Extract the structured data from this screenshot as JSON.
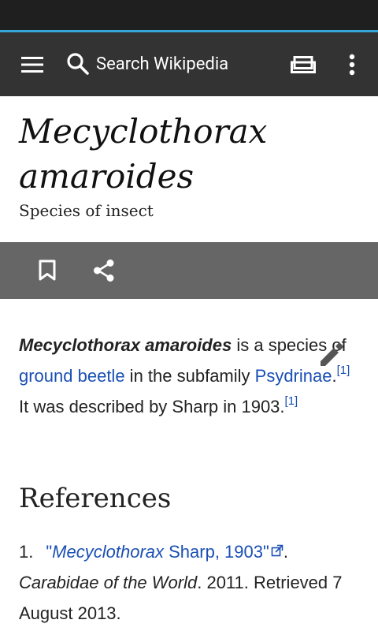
{
  "toolbar": {
    "search_placeholder": "Search Wikipedia"
  },
  "article": {
    "title": "Mecyclothorax amaroides",
    "description": "Species of insect",
    "lead": {
      "subject": "Mecyclothorax amaroides",
      "text_1": " is a species of ",
      "link_1": "ground beetle",
      "text_2": " in the subfamily ",
      "link_2": "Psydrinae",
      "text_3": ".",
      "ref_1": "[1]",
      "text_4": " It was described by Sharp in 1903.",
      "ref_2": "[1]"
    },
    "references_heading": "References",
    "references": [
      {
        "number": "1.",
        "link_open_quote": "\"",
        "link_italic": "Mecyclothorax",
        "link_text": " Sharp, 1903\"",
        "text_after_link": ". ",
        "source": "Carabidae of the World",
        "rest": ". 2011. Retrieved 7 August 2013."
      }
    ]
  },
  "colors": {
    "toolbar": "#333333",
    "status_bar": "#1f1f1f",
    "accent_line": "#33a7d8",
    "action_bar": "#666666",
    "link": "#1a4fb4"
  },
  "icons": {
    "menu": "hamburger-menu-icon",
    "search": "search-icon",
    "reading_list": "reading-list-icon",
    "overflow": "more-vert-icon",
    "bookmark": "bookmark-icon",
    "share": "share-icon",
    "edit": "pencil-icon",
    "external": "external-link-icon"
  }
}
